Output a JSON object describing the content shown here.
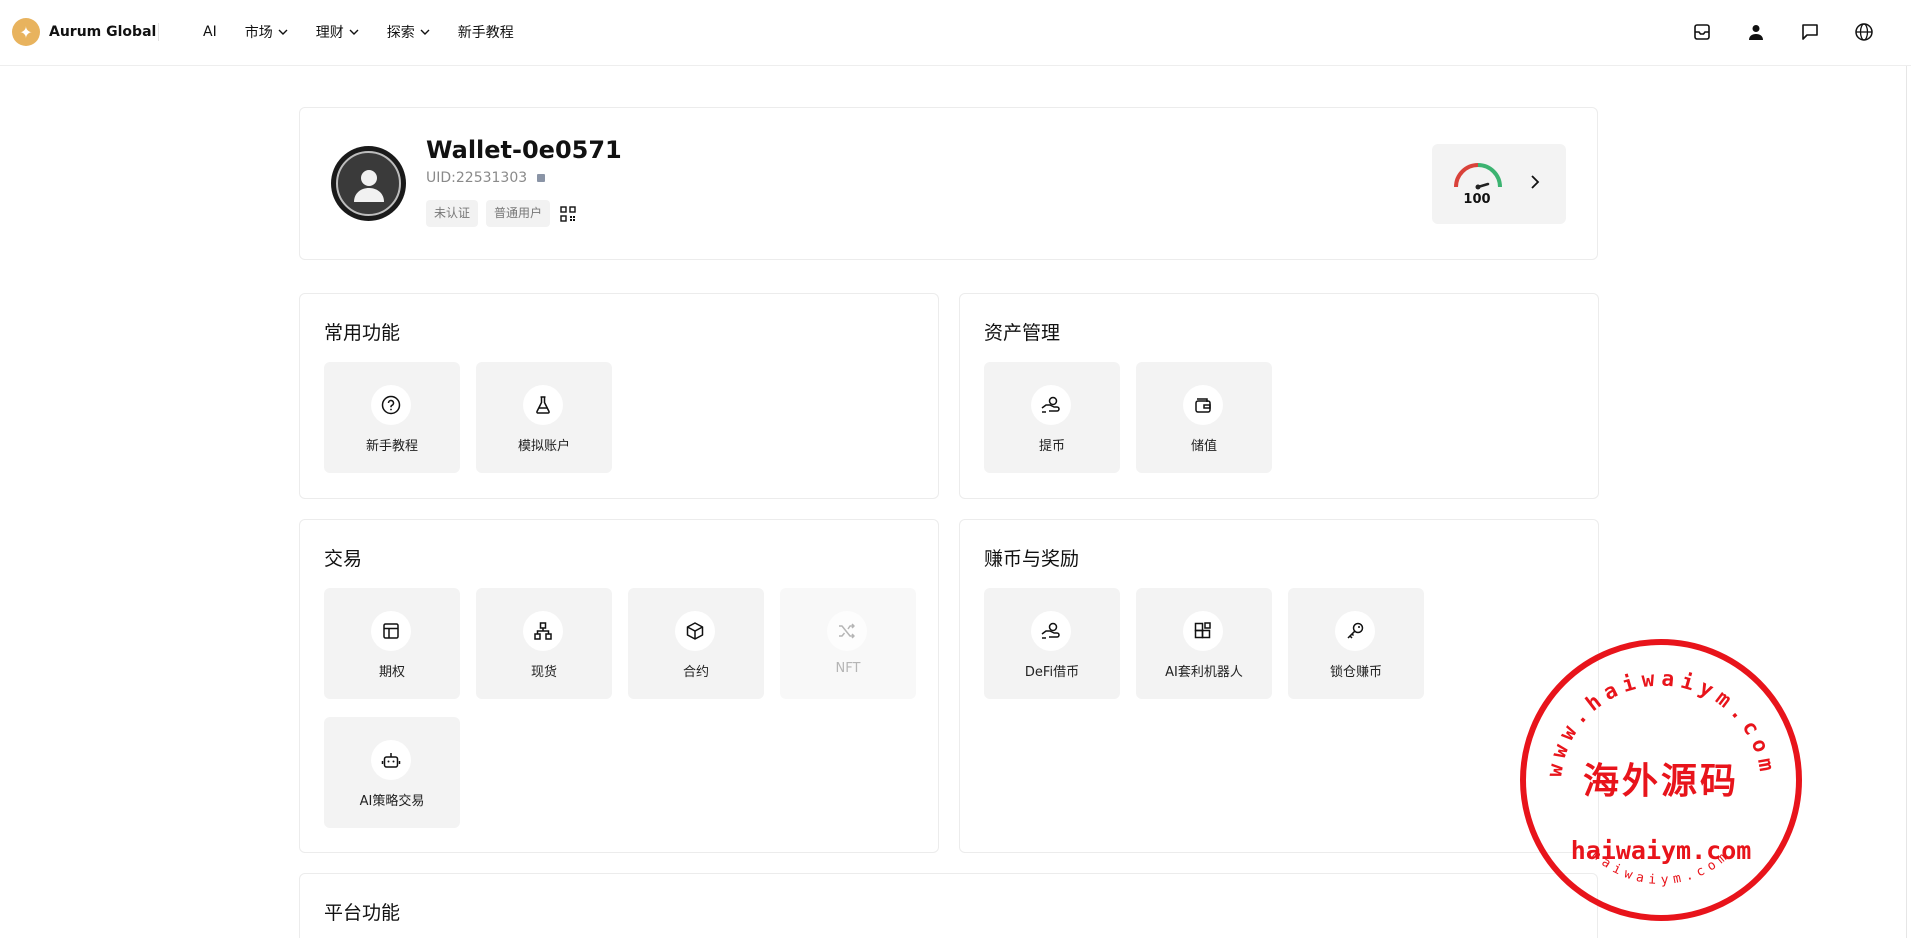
{
  "header": {
    "brand": "Aurum Global",
    "nav": [
      {
        "label": "AI",
        "dropdown": false
      },
      {
        "label": "市场",
        "dropdown": true
      },
      {
        "label": "理财",
        "dropdown": true
      },
      {
        "label": "探索",
        "dropdown": true
      },
      {
        "label": "新手教程",
        "dropdown": false
      }
    ],
    "icons": [
      "mailbox-icon",
      "user-icon",
      "chat-icon",
      "globe-icon"
    ]
  },
  "profile": {
    "wallet_name": "Wallet-0e0571",
    "uid": "UID:22531303",
    "tags": [
      "未认证",
      "普通用户"
    ],
    "score": "100"
  },
  "sections": {
    "common": {
      "title": "常用功能",
      "items": [
        {
          "label": "新手教程",
          "icon": "question-icon"
        },
        {
          "label": "模拟账户",
          "icon": "flask-icon"
        }
      ]
    },
    "asset": {
      "title": "资产管理",
      "items": [
        {
          "label": "提币",
          "icon": "hand-coin-icon"
        },
        {
          "label": "储值",
          "icon": "wallet-icon"
        }
      ]
    },
    "trade": {
      "title": "交易",
      "items": [
        {
          "label": "期权",
          "icon": "layout-icon"
        },
        {
          "label": "现货",
          "icon": "network-icon"
        },
        {
          "label": "合约",
          "icon": "box-icon"
        },
        {
          "label": "NFT",
          "icon": "shuffle-icon"
        },
        {
          "label": "AI策略交易",
          "icon": "robot-icon"
        }
      ]
    },
    "earn": {
      "title": "赚币与奖励",
      "items": [
        {
          "label": "DeFi借币",
          "icon": "hand-coin-icon"
        },
        {
          "label": "AI套利机器人",
          "icon": "blocks-icon"
        },
        {
          "label": "锁仓赚币",
          "icon": "key-icon"
        }
      ]
    },
    "platform": {
      "title": "平台功能"
    }
  },
  "watermark": {
    "ring_text": "www.haiwaiym.com",
    "main_text": "海外源码",
    "domain_text": "haiwaiym.com",
    "small_text": "haiwaiym.com"
  },
  "colors": {
    "accent": "#e8b35e",
    "tile_bg": "#f3f3f3",
    "stamp_red": "#e8141b",
    "gauge_red": "#d9423a",
    "gauge_green": "#3cb371"
  }
}
